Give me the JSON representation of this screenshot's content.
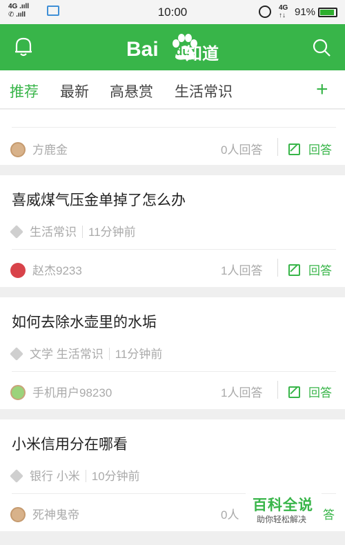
{
  "status_bar": {
    "signal_top": "4G .ııll",
    "signal_bottom": "✆ .ııll",
    "time": "10:00",
    "network": "4G",
    "network_sub": "↑↓",
    "battery": "91%",
    "battery_level": 0.91
  },
  "app_bar": {
    "logo_bai": "Bai",
    "logo_du": "du",
    "logo_zhidao": "知道",
    "brand_color": "#38b549"
  },
  "tabs": {
    "items": [
      "推荐",
      "最新",
      "高悬赏",
      "生活常识"
    ],
    "active_index": 0,
    "add_label": "+"
  },
  "partial_card": {
    "user": "方鹿金",
    "count": "0人回答",
    "answer_label": "回答"
  },
  "questions": [
    {
      "title": "喜威煤气压金单掉了怎么办",
      "tags": "生活常识",
      "time": "11分钟前",
      "user": "赵杰9233",
      "count": "1人回答",
      "answer_label": "回答"
    },
    {
      "title": "如何去除水壶里的水垢",
      "tags": "文学  生活常识",
      "time": "11分钟前",
      "user": "手机用户98230",
      "count": "1人回答",
      "answer_label": "回答"
    },
    {
      "title": "小米信用分在哪看",
      "tags": "银行  小米",
      "time": "10分钟前",
      "user": "死神鬼帝",
      "count": "0人",
      "answer_label": "答"
    }
  ],
  "watermark": {
    "title": "百科全说",
    "subtitle": "助你轻松解决"
  }
}
